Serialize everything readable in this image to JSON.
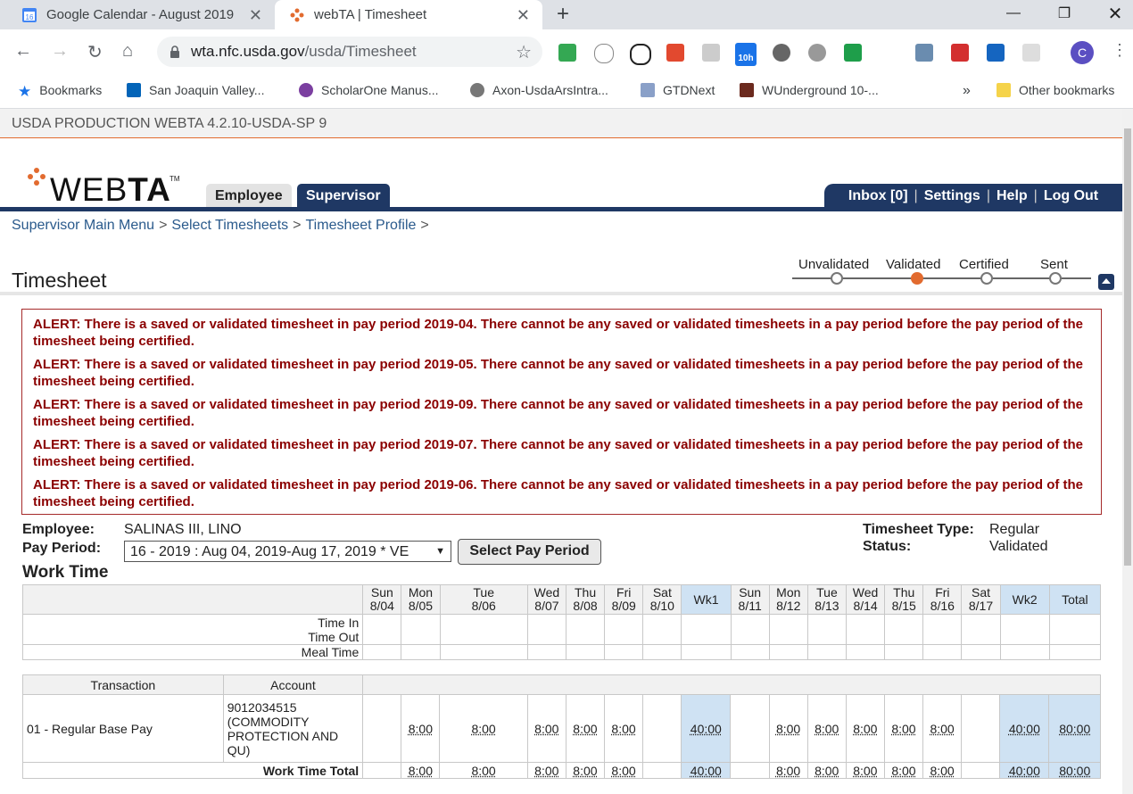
{
  "browser": {
    "tabs": [
      {
        "title": "Google Calendar - August 2019",
        "icon": "calendar-icon"
      },
      {
        "title": "webTA | Timesheet",
        "icon": "webta-icon"
      }
    ],
    "url_host": "wta.nfc.usda.gov",
    "url_path": "/usda/Timesheet",
    "extension_badge": "10h",
    "profile_initial": "C",
    "bookmarks": [
      {
        "label": "Bookmarks"
      },
      {
        "label": "San Joaquin Valley..."
      },
      {
        "label": "ScholarOne Manus..."
      },
      {
        "label": "Axon-UsdaArsIntra..."
      },
      {
        "label": "GTDNext"
      },
      {
        "label": "WUnderground 10-..."
      }
    ],
    "bookmarks_overflow": "»",
    "other_bookmarks": "Other bookmarks"
  },
  "env_banner": "USDA PRODUCTION WEBTA 4.2.10-USDA-SP 9",
  "logo": {
    "light": "WEB",
    "bold": "TA",
    "tm": "TM"
  },
  "nav_tabs": {
    "employee": "Employee",
    "supervisor": "Supervisor"
  },
  "right_nav": {
    "inbox": "Inbox [0]",
    "settings": "Settings",
    "help": "Help",
    "logout": "Log Out",
    "sep": "|"
  },
  "breadcrumb": {
    "item1": "Supervisor Main Menu",
    "item2": "Select Timesheets",
    "item3": "Timesheet Profile",
    "sep": ">"
  },
  "page_title": "Timesheet",
  "status_steps": [
    "Unvalidated",
    "Validated",
    "Certified",
    "Sent"
  ],
  "active_step": "Validated",
  "alerts": [
    "ALERT: There is a saved or validated timesheet in pay period 2019-04. There cannot be any saved or validated timesheets in a pay period before the pay period of the timesheet being certified.",
    "ALERT: There is a saved or validated timesheet in pay period 2019-05. There cannot be any saved or validated timesheets in a pay period before the pay period of the timesheet being certified.",
    "ALERT: There is a saved or validated timesheet in pay period 2019-09. There cannot be any saved or validated timesheets in a pay period before the pay period of the timesheet being certified.",
    "ALERT: There is a saved or validated timesheet in pay period 2019-07. There cannot be any saved or validated timesheets in a pay period before the pay period of the timesheet being certified.",
    "ALERT: There is a saved or validated timesheet in pay period 2019-06. There cannot be any saved or validated timesheets in a pay period before the pay period of the timesheet being certified."
  ],
  "employee": {
    "employee_label": "Employee:",
    "employee_value": "SALINAS III, LINO",
    "pay_period_label": "Pay Period:",
    "pay_period_value": "16 - 2019 : Aug 04, 2019-Aug 17, 2019 * VE",
    "select_button": "Select Pay Period",
    "timesheet_type_label": "Timesheet Type:",
    "timesheet_type_value": "Regular",
    "status_label": "Status:",
    "status_value": "Validated"
  },
  "work_time": {
    "title": "Work Time",
    "days": [
      {
        "d": "Sun",
        "date": "8/04"
      },
      {
        "d": "Mon",
        "date": "8/05"
      },
      {
        "d": "Tue",
        "date": "8/06"
      },
      {
        "d": "Wed",
        "date": "8/07"
      },
      {
        "d": "Thu",
        "date": "8/08"
      },
      {
        "d": "Fri",
        "date": "8/09"
      },
      {
        "d": "Sat",
        "date": "8/10"
      },
      {
        "wk": "Wk1"
      },
      {
        "d": "Sun",
        "date": "8/11"
      },
      {
        "d": "Mon",
        "date": "8/12"
      },
      {
        "d": "Tue",
        "date": "8/13"
      },
      {
        "d": "Wed",
        "date": "8/14"
      },
      {
        "d": "Thu",
        "date": "8/15"
      },
      {
        "d": "Fri",
        "date": "8/16"
      },
      {
        "d": "Sat",
        "date": "8/17"
      },
      {
        "wk": "Wk2"
      },
      {
        "wk": "Total"
      }
    ],
    "row_labels": {
      "time_in": "Time In",
      "time_out": "Time Out",
      "meal_time": "Meal Time"
    },
    "transaction_header": "Transaction",
    "account_header": "Account",
    "transaction": "01 - Regular Base Pay",
    "account": "9012034515 (COMMODITY PROTECTION AND QU)",
    "hours": [
      "",
      "8:00",
      "8:00",
      "8:00",
      "8:00",
      "8:00",
      "",
      "40:00",
      "",
      "8:00",
      "8:00",
      "8:00",
      "8:00",
      "8:00",
      "",
      "40:00",
      "80:00"
    ],
    "total_label": "Work Time Total",
    "totals": [
      "",
      "8:00",
      "8:00",
      "8:00",
      "8:00",
      "8:00",
      "",
      "40:00",
      "",
      "8:00",
      "8:00",
      "8:00",
      "8:00",
      "8:00",
      "",
      "40:00",
      "80:00"
    ]
  }
}
